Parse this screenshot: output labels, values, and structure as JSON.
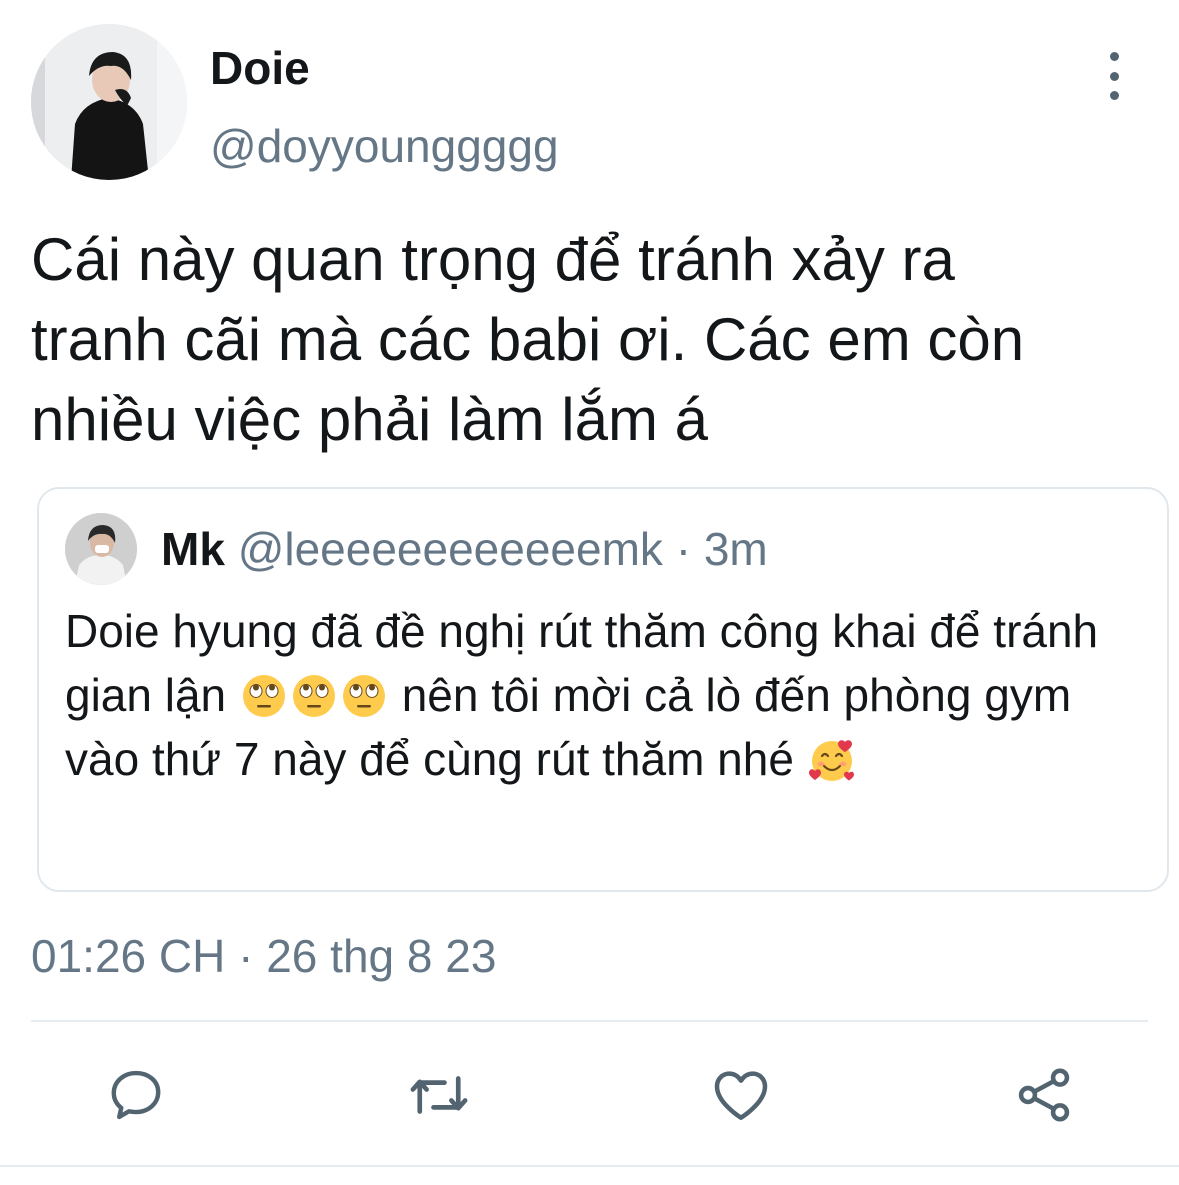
{
  "author": {
    "display_name": "Doie",
    "handle": "@doyyounggggg"
  },
  "tweet": {
    "text": "Cái này quan trọng để tránh xảy ra\ntranh cãi mà các babi ơi. Các em còn\nnhiều việc phải làm lắm á",
    "timestamp": "01:26 CH · 26 thg 8 23"
  },
  "quoted": {
    "display_name": "Mk",
    "handle": "@leeeeeeeeeeeemk",
    "separator": " · ",
    "time": "3m",
    "text_part1": "Doie hyung đã đề nghị rút thăm công khai để tránh gian lận ",
    "text_part2": " nên tôi mời cả lò đến phòng gym vào thứ 7 này để cùng rút thăm nhé ",
    "emojis": [
      "face-with-rolling-eyes-emoji",
      "face-with-rolling-eyes-emoji",
      "face-with-rolling-eyes-emoji",
      "smiling-face-with-hearts-emoji"
    ]
  },
  "actions": [
    "reply-icon",
    "retweet-icon",
    "like-icon",
    "share-icon"
  ],
  "colors": {
    "text": "#14171a",
    "secondary": "#657786",
    "border": "#e1e8ed",
    "icon": "#536471",
    "emoji_yellow": "#ffcb4c",
    "heart_red": "#e2384d"
  }
}
